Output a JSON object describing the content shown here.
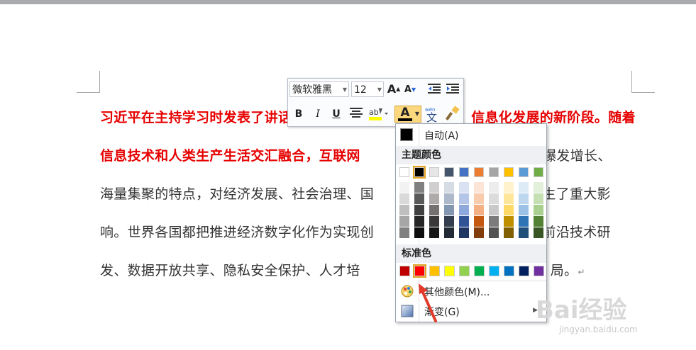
{
  "document": {
    "lines": [
      {
        "segments": [
          {
            "text": "习近平在主持学习时发表了讲话",
            "red": true
          },
          {
            "text": "信息化发展的新阶段。随着",
            "red": true
          }
        ]
      },
      {
        "segments": [
          {
            "text": "信息技术和人类生产生活交汇融合，互联网",
            "red": true
          },
          {
            "text": "现爆发增长、",
            "red": false
          }
        ]
      },
      {
        "segments": [
          {
            "text": "海量集聚的特点，对经济发展、社会治理、国",
            "red": false
          },
          {
            "text": "产生了重大影",
            "red": false
          }
        ]
      },
      {
        "segments": [
          {
            "text": "响。世界各国都把推进经济数字化作为实现创",
            "red": false
          },
          {
            "text": "在前沿技术研",
            "red": false
          }
        ]
      },
      {
        "segments": [
          {
            "text": "发、数据开放共享、隐私安全保护、人才培",
            "red": false
          },
          {
            "text": "局。",
            "red": false
          }
        ]
      }
    ],
    "paragraph_mark": "↵"
  },
  "mini_toolbar": {
    "font_name": "微软雅黑",
    "font_size": "12",
    "grow_font": "A",
    "shrink_font": "A",
    "bold": "B",
    "italic": "I",
    "underline": "U",
    "font_color_glyph": "A",
    "format_painter_label": "wén",
    "phonetic_char": "文"
  },
  "color_panel": {
    "automatic_label": "自动(A)",
    "theme_colors_label": "主题颜色",
    "standard_colors_label": "标准色",
    "more_colors_label": "其他颜色(M)...",
    "gradient_label": "渐变(G)",
    "theme_top_row": [
      "#ffffff",
      "#000000",
      "#eeece1",
      "#1f497d",
      "#4f81bd",
      "#c0504d",
      "#9bbb59",
      "#8064a2",
      "#4bacc6",
      "#f79646"
    ],
    "theme_columns": [
      [
        "#f2f2f2",
        "#d8d8d8",
        "#bfbfbf",
        "#a5a5a5",
        "#7f7f7f"
      ],
      [
        "#7f7f7f",
        "#595959",
        "#3f3f3f",
        "#262626",
        "#0c0c0c"
      ],
      [
        "#dddddd",
        "#c4c4c4",
        "#a8a8a8",
        "#7f7f7f",
        "#595959"
      ],
      [
        "#c6d9f0",
        "#8db3e2",
        "#548dd4",
        "#17365d",
        "#0f243e"
      ],
      [
        "#dbe5f1",
        "#b8cce4",
        "#95b3d7",
        "#366092",
        "#244061"
      ],
      [
        "#fdeada",
        "#fbd5b5",
        "#fac08f",
        "#e36c09",
        "#974806"
      ],
      [
        "#f2f2f2",
        "#d8d8d8",
        "#bfbfbf",
        "#7f7f7f",
        "#3f3f3f"
      ],
      [
        "#fff2ca",
        "#ffe694",
        "#ffd965",
        "#bf9000",
        "#7f6000"
      ],
      [
        "#dbeef3",
        "#b7dde8",
        "#92cddc",
        "#31859b",
        "#205867"
      ],
      [
        "#ebf1dd",
        "#d7e3bc",
        "#c3d69b",
        "#76923c",
        "#4f6128"
      ]
    ],
    "theme_top_row_display": [
      "#ffffff",
      "#000000",
      "#e7e6e6",
      "#44546a",
      "#4472c4",
      "#ed7d31",
      "#a5a5a5",
      "#ffc000",
      "#5b9bd5",
      "#70ad47"
    ],
    "standard_colors": [
      "#c00000",
      "#ff0000",
      "#ffc000",
      "#ffff00",
      "#92d050",
      "#00b050",
      "#00b0f0",
      "#0070c0",
      "#002060",
      "#7030a0"
    ],
    "selected_theme_index": 1,
    "selected_standard_index": 1
  },
  "watermark": {
    "logo": "Bai经验",
    "url": "jingyan.baidu.com"
  }
}
